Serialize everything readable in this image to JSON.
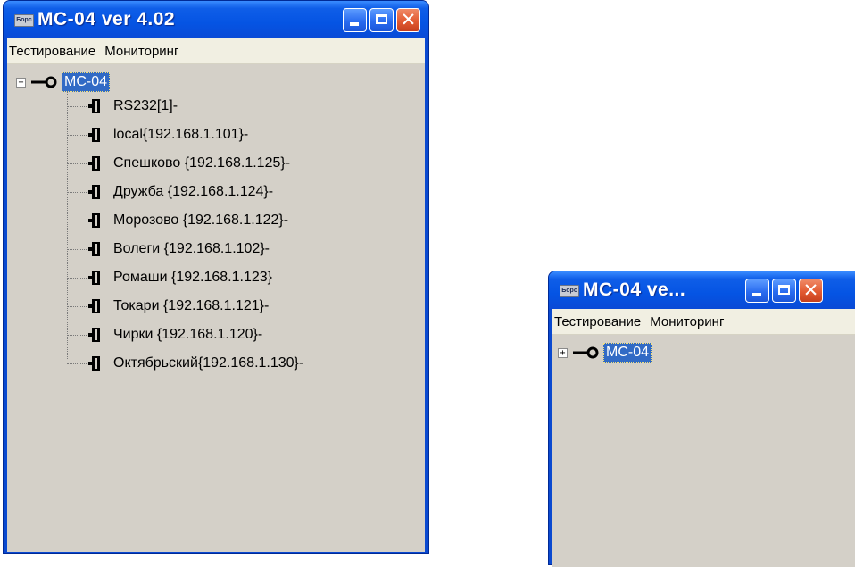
{
  "windows": [
    {
      "icon_text": "Бopc",
      "title": "МС-04  ver 4.02",
      "menu": [
        "Тестирование",
        "Мониторинг"
      ],
      "tree": {
        "root": "MC-04",
        "expander": "−",
        "children": [
          "RS232[1]-",
          "local{192.168.1.101}-",
          "Спешково  {192.168.1.125}-",
          "Дружба {192.168.1.124}-",
          "Морозово {192.168.1.122}-",
          "Волеги {192.168.1.102}-",
          "Ромаши {192.168.1.123}",
          "Токари {192.168.1.121}-",
          "Чирки {192.168.1.120}-",
          "Октябрьский{192.168.1.130}-"
        ]
      }
    },
    {
      "icon_text": "Бopc",
      "title": "МС-04  ve...",
      "menu": [
        "Тестирование",
        "Мониторинг"
      ],
      "tree": {
        "root": "MC-04",
        "expander": "+"
      }
    }
  ],
  "icons": {
    "app": "app-logo-icon",
    "minimize": "minimize-icon",
    "maximize": "maximize-icon",
    "close": "close-icon",
    "root": "key-connector-icon",
    "child": "port-connector-icon"
  },
  "colors": {
    "title_bar": "#0554e3",
    "selection": "#316ac5",
    "content_bg": "#d4d0c8",
    "menu_bg": "#f1efe2",
    "close_button": "#e25a32"
  }
}
